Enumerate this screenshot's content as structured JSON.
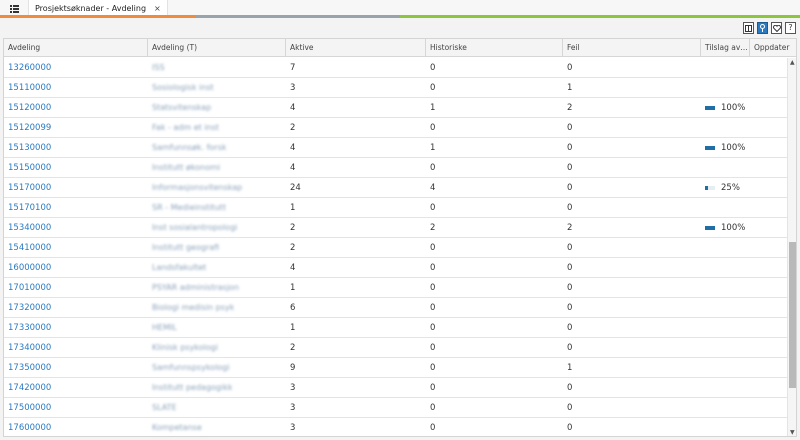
{
  "tab": {
    "title": "Prosjektsøknader - Avdeling",
    "close_glyph": "×"
  },
  "accents": [
    "#f08a3c",
    "#9aa3ac",
    "#8cc63f"
  ],
  "toolbar": {
    "icons": [
      "split-view-icon",
      "info-icon",
      "favorite-icon",
      "help-icon"
    ],
    "help_label": "?"
  },
  "columns": [
    "Avdeling",
    "Avdeling (T)",
    "Aktive",
    "Historiske",
    "Feil",
    "Tilslag avdeling",
    "Oppdater"
  ],
  "rows": [
    {
      "avdeling": "13260000",
      "navn": "ISS",
      "aktive": "7",
      "historiske": "0",
      "feil": "0"
    },
    {
      "avdeling": "15110000",
      "navn": "Sosiologisk inst",
      "aktive": "3",
      "historiske": "0",
      "feil": "1"
    },
    {
      "avdeling": "15120000",
      "navn": "Statsvitenskap",
      "aktive": "4",
      "historiske": "1",
      "feil": "2",
      "tilslag": "100%",
      "tilslag_frac": 1.0
    },
    {
      "avdeling": "15120099",
      "navn": "Fak - adm et inst",
      "aktive": "2",
      "historiske": "0",
      "feil": "0"
    },
    {
      "avdeling": "15130000",
      "navn": "Samfunnsøk. forsk",
      "aktive": "4",
      "historiske": "1",
      "feil": "0",
      "tilslag": "100%",
      "tilslag_frac": 1.0
    },
    {
      "avdeling": "15150000",
      "navn": "Institutt økonomi",
      "aktive": "4",
      "historiske": "0",
      "feil": "0"
    },
    {
      "avdeling": "15170000",
      "navn": "Informasjonsvitenskap",
      "aktive": "24",
      "historiske": "4",
      "feil": "0",
      "tilslag": "25%",
      "tilslag_frac": 0.25
    },
    {
      "avdeling": "15170100",
      "navn": "SR - Medieinstitutt",
      "aktive": "1",
      "historiske": "0",
      "feil": "0"
    },
    {
      "avdeling": "15340000",
      "navn": "Inst sosialantropologi",
      "aktive": "2",
      "historiske": "2",
      "feil": "2",
      "tilslag": "100%",
      "tilslag_frac": 1.0
    },
    {
      "avdeling": "15410000",
      "navn": "Institutt geografi",
      "aktive": "2",
      "historiske": "0",
      "feil": "0"
    },
    {
      "avdeling": "16000000",
      "navn": "Landsfakultet",
      "aktive": "4",
      "historiske": "0",
      "feil": "0"
    },
    {
      "avdeling": "17010000",
      "navn": "PSYAR administrasjon",
      "aktive": "1",
      "historiske": "0",
      "feil": "0"
    },
    {
      "avdeling": "17320000",
      "navn": "Biologi medisin psyk",
      "aktive": "6",
      "historiske": "0",
      "feil": "0"
    },
    {
      "avdeling": "17330000",
      "navn": "HEMIL",
      "aktive": "1",
      "historiske": "0",
      "feil": "0"
    },
    {
      "avdeling": "17340000",
      "navn": "Klinisk psykologi",
      "aktive": "2",
      "historiske": "0",
      "feil": "0"
    },
    {
      "avdeling": "17350000",
      "navn": "Samfunnspsykologi",
      "aktive": "9",
      "historiske": "0",
      "feil": "1"
    },
    {
      "avdeling": "17420000",
      "navn": "Institutt pedagogikk",
      "aktive": "3",
      "historiske": "0",
      "feil": "0"
    },
    {
      "avdeling": "17500000",
      "navn": "SLATE",
      "aktive": "3",
      "historiske": "0",
      "feil": "0"
    },
    {
      "avdeling": "17600000",
      "navn": "Kompetanse",
      "aktive": "3",
      "historiske": "0",
      "feil": "0"
    }
  ]
}
